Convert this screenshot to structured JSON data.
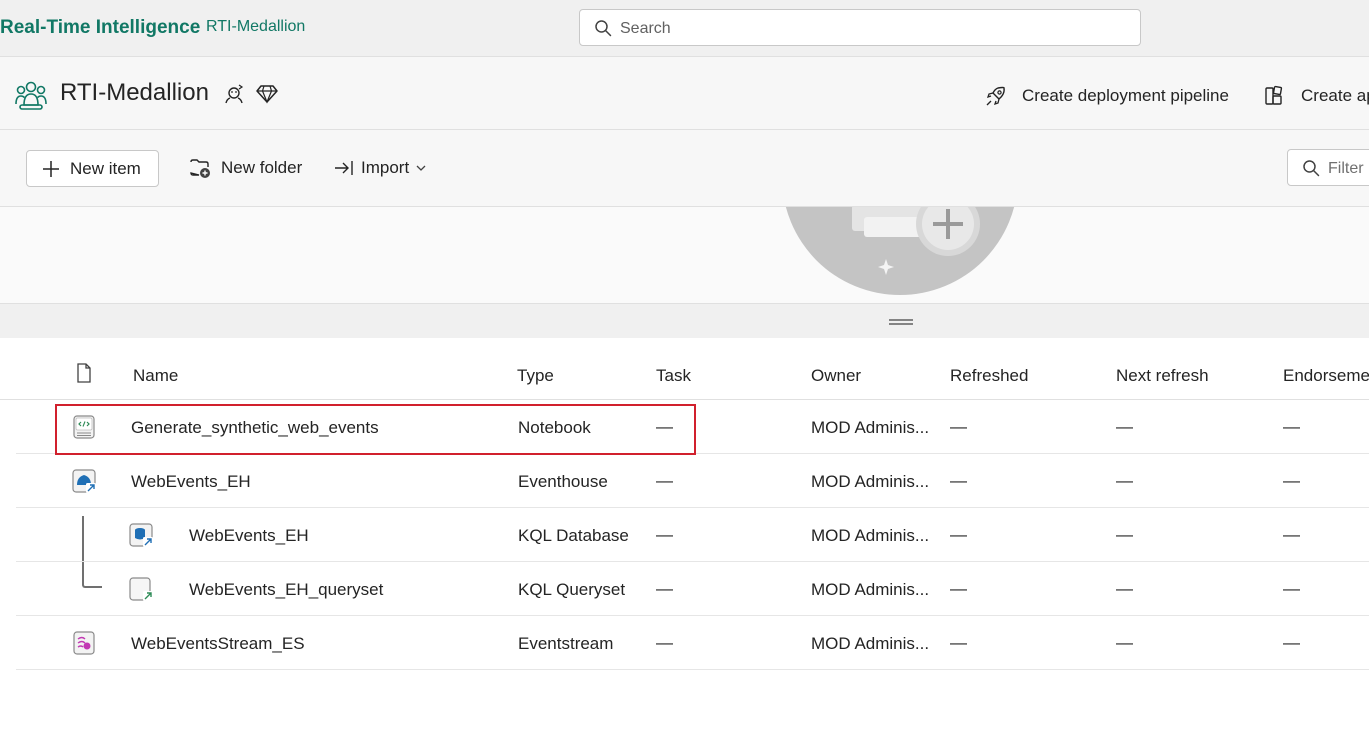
{
  "topbar": {
    "brand": "Real-Time Intelligence",
    "breadcrumb": "RTI-Medallion",
    "search_placeholder": "Search"
  },
  "workspace": {
    "title": "RTI-Medallion",
    "actions": {
      "deploy_label": "Create deployment pipeline",
      "create_app_label": "Create ap"
    }
  },
  "toolbar": {
    "new_item_label": "New item",
    "new_folder_label": "New folder",
    "import_label": "Import",
    "filter_placeholder": "Filter"
  },
  "table": {
    "headers": {
      "name": "Name",
      "type": "Type",
      "task": "Task",
      "owner": "Owner",
      "refreshed": "Refreshed",
      "next_refresh": "Next refresh",
      "endorsement": "Endorsemer"
    },
    "rows": [
      {
        "icon": "notebook-icon",
        "name": "Generate_synthetic_web_events",
        "type": "Notebook",
        "task": "—",
        "owner": "MOD Adminis...",
        "refreshed": "—",
        "next_refresh": "—",
        "endorsement": "—",
        "highlighted": true
      },
      {
        "icon": "eventhouse-icon",
        "name": "WebEvents_EH",
        "type": "Eventhouse",
        "task": "—",
        "owner": "MOD Adminis...",
        "refreshed": "—",
        "next_refresh": "—",
        "endorsement": "—"
      },
      {
        "icon": "kql-database-icon",
        "name": "WebEvents_EH",
        "type": "KQL Database",
        "task": "—",
        "owner": "MOD Adminis...",
        "refreshed": "—",
        "next_refresh": "—",
        "endorsement": "—",
        "child": true
      },
      {
        "icon": "kql-queryset-icon",
        "name": "WebEvents_EH_queryset",
        "type": "KQL Queryset",
        "task": "—",
        "owner": "MOD Adminis...",
        "refreshed": "—",
        "next_refresh": "—",
        "endorsement": "—",
        "child": true
      },
      {
        "icon": "eventstream-icon",
        "name": "WebEventsStream_ES",
        "type": "Eventstream",
        "task": "—",
        "owner": "MOD Adminis...",
        "refreshed": "—",
        "next_refresh": "—",
        "endorsement": "—"
      }
    ]
  },
  "colors": {
    "brand": "#117865",
    "highlight": "#d1202d"
  }
}
